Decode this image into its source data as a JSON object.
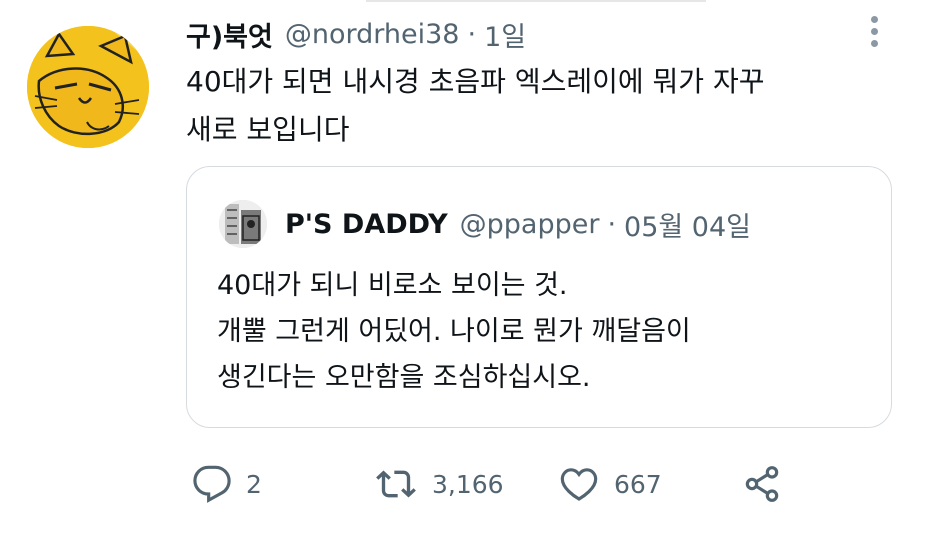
{
  "tweet": {
    "display_name": "구)북엇",
    "handle": "@nordrhei38",
    "separator": "·",
    "time": "1일",
    "text": "40대가 되면 내시경 초음파 엑스레이에 뭐가 자꾸\n새로 보입니다"
  },
  "quoted_tweet": {
    "display_name": "P'S DADDY",
    "handle": "@ppapper",
    "separator": "·",
    "time": "05월 04일",
    "text": "40대가 되니 비로소 보이는 것.\n개뿔 그런게 어딨어. 나이로 뭔가 깨달음이\n생긴다는 오만함을 조심하십시오."
  },
  "actions": {
    "reply_count": "2",
    "retweet_count": "3,166",
    "like_count": "667"
  },
  "icons": {
    "reply": "reply-icon",
    "retweet": "retweet-icon",
    "like": "heart-icon",
    "share": "share-icon",
    "more": "more-vertical-icon"
  },
  "colors": {
    "text": "#0f1419",
    "secondary": "#536471",
    "border": "#d6dbdf",
    "avatar_yellow": "#f3c21c"
  }
}
